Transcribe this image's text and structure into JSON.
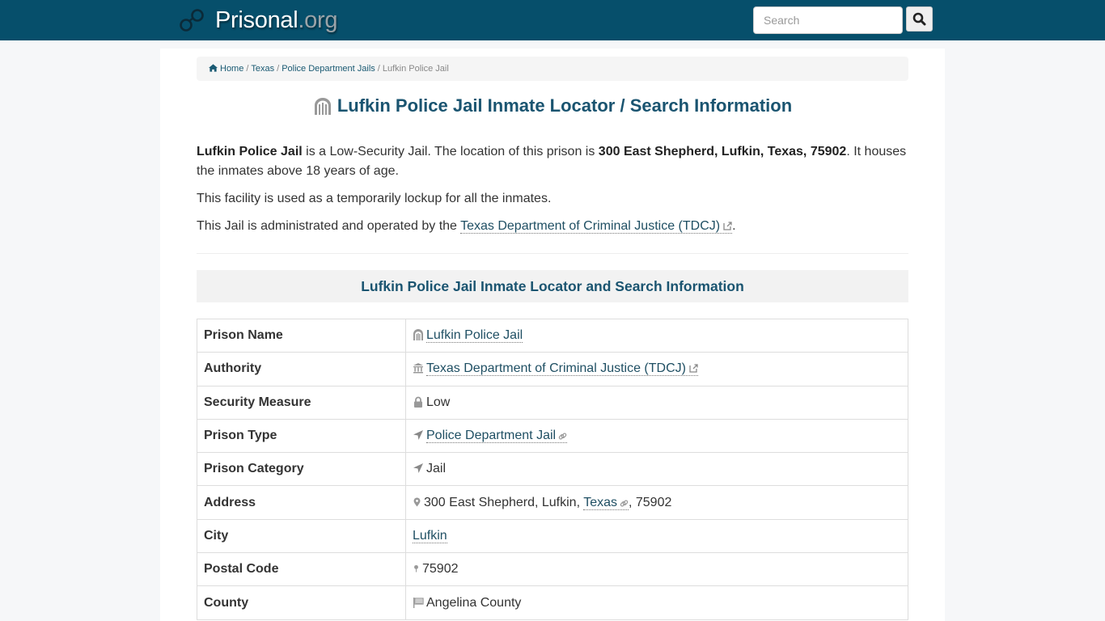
{
  "header": {
    "logo_icon": "handcuffs-icon",
    "brand_name": "Prisonal",
    "brand_tld": ".org",
    "search_placeholder": "Search",
    "search_button_icon": "search-icon"
  },
  "breadcrumb": [
    {
      "label": "Home",
      "icon": "home-icon"
    },
    {
      "label": "Texas"
    },
    {
      "label": "Police Department Jails"
    },
    {
      "label": "Lufkin Police Jail",
      "active": true
    }
  ],
  "page_title": "Lufkin Police Jail Inmate Locator / Search Information",
  "intro": {
    "p1_name": "Lufkin Police Jail",
    "p1_mid": " is a Low-Security Jail. The location of this prison is ",
    "p1_address": "300 East Shepherd, Lufkin, Texas, 75902",
    "p1_end": ". It houses the inmates above 18 years of age.",
    "p2": "This facility is used as a temporarily lockup for all the inmates.",
    "p3_start": "This Jail is administrated and operated by the ",
    "p3_link": "Texas Department of Criminal Justice (TDCJ)",
    "p3_end": "."
  },
  "section_title": "Lufkin Police Jail Inmate Locator and Search Information",
  "table": {
    "rows": [
      {
        "label": "Prison Name",
        "icon": "jail-icon",
        "value": "Lufkin Police Jail"
      },
      {
        "label": "Authority",
        "icon": "bank-icon",
        "value": "Texas Department of Criminal Justice (TDCJ)"
      },
      {
        "label": "Security Measure",
        "icon": "lock-icon",
        "value": "Low"
      },
      {
        "label": "Prison Type",
        "icon": "location-arrow-icon",
        "value": "Police Department Jail"
      },
      {
        "label": "Prison Category",
        "icon": "location-arrow-icon",
        "value": "Jail"
      },
      {
        "label": "Address",
        "icon": "map-marker-icon",
        "value_street": "300 East Shepherd, Lufkin, ",
        "value_state": "Texas",
        "value_zip": ", 75902"
      },
      {
        "label": "City",
        "value": "Lufkin"
      },
      {
        "label": "Postal Code",
        "icon": "map-pin-icon",
        "value": "75902"
      },
      {
        "label": "County",
        "icon": "flag-icon",
        "value": "Angelina County"
      }
    ]
  }
}
